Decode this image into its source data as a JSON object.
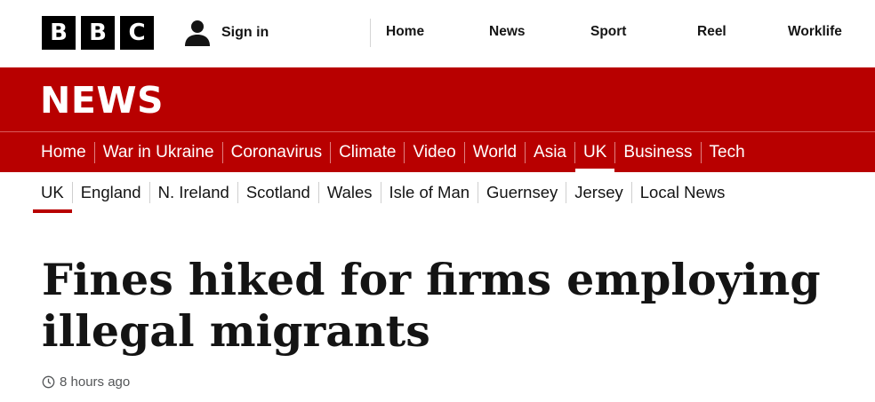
{
  "logo": {
    "letters": [
      "B",
      "B",
      "C"
    ]
  },
  "account": {
    "sign_in_label": "Sign in",
    "icon": "user-icon"
  },
  "top_nav": [
    {
      "label": "Home"
    },
    {
      "label": "News"
    },
    {
      "label": "Sport"
    },
    {
      "label": "Reel"
    },
    {
      "label": "Worklife"
    }
  ],
  "banner": {
    "wordmark": "NEWS",
    "color": "#b80000"
  },
  "main_nav": [
    {
      "label": "Home",
      "active": false
    },
    {
      "label": "War in Ukraine",
      "active": false
    },
    {
      "label": "Coronavirus",
      "active": false
    },
    {
      "label": "Climate",
      "active": false
    },
    {
      "label": "Video",
      "active": false
    },
    {
      "label": "World",
      "active": false
    },
    {
      "label": "Asia",
      "active": false
    },
    {
      "label": "UK",
      "active": true
    },
    {
      "label": "Business",
      "active": false
    },
    {
      "label": "Tech",
      "active": false
    }
  ],
  "sub_nav": [
    {
      "label": "UK",
      "active": true
    },
    {
      "label": "England",
      "active": false
    },
    {
      "label": "N. Ireland",
      "active": false
    },
    {
      "label": "Scotland",
      "active": false
    },
    {
      "label": "Wales",
      "active": false
    },
    {
      "label": "Isle of Man",
      "active": false
    },
    {
      "label": "Guernsey",
      "active": false
    },
    {
      "label": "Jersey",
      "active": false
    },
    {
      "label": "Local News",
      "active": false
    }
  ],
  "article": {
    "headline": "Fines hiked for firms employing illegal migrants",
    "timestamp": "8 hours ago",
    "timestamp_icon": "clock-icon"
  }
}
